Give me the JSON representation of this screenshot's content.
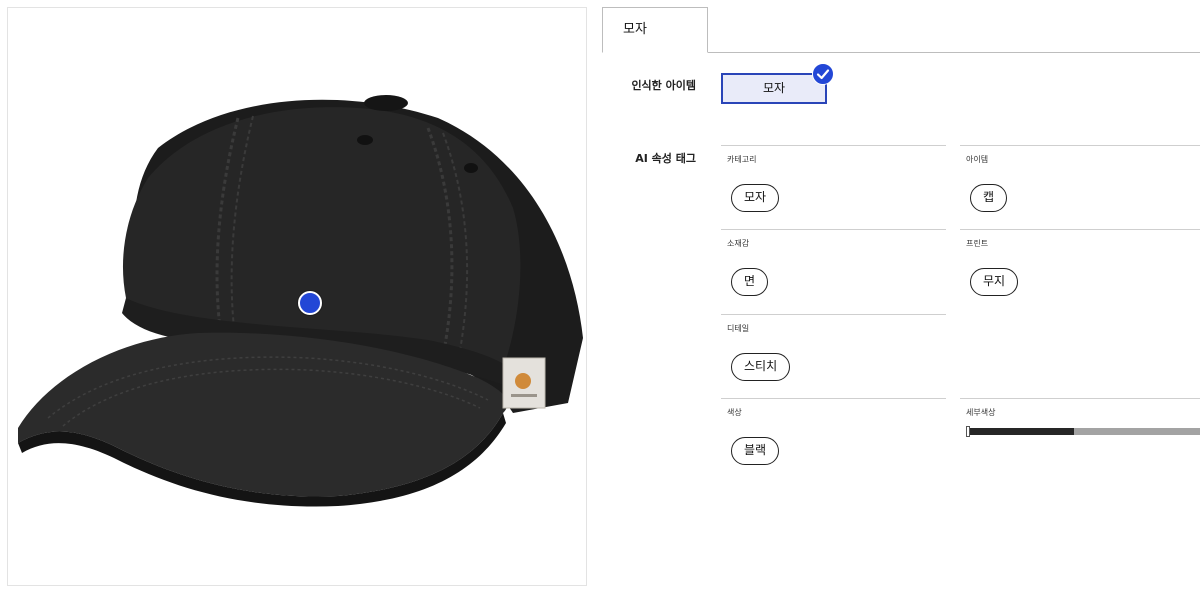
{
  "tabs": [
    {
      "label": "모자",
      "active": true
    }
  ],
  "recognized_items": {
    "label": "인식한 아이템",
    "items": [
      {
        "label": "모자",
        "selected": true
      }
    ]
  },
  "ai_tags": {
    "label": "AI 속성 태그",
    "groups": [
      {
        "title": "카테고리",
        "value": "모자"
      },
      {
        "title": "아이템",
        "value": "캡"
      },
      {
        "title": "소재감",
        "value": "면"
      },
      {
        "title": "프린트",
        "value": "무지"
      },
      {
        "title": "디테일",
        "value": "스티치"
      },
      {
        "title": "색상",
        "value": "블랙"
      },
      {
        "title": "세부색상",
        "value": ""
      }
    ],
    "sub_color_ratio": [
      {
        "color": "#262626",
        "ratio": 0.45
      },
      {
        "color": "#a3a3a3",
        "ratio": 0.55
      }
    ]
  },
  "colors": {
    "accent": "#2347d6",
    "chip_bg": "#e9ebf9"
  },
  "icons": {
    "check": "check-icon",
    "hotspot": "hotspot-marker"
  }
}
